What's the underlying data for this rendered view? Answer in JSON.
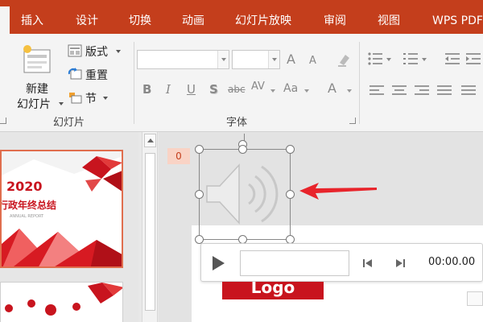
{
  "ribbon_tabs": [
    "插入",
    "设计",
    "切换",
    "动画",
    "幻灯片放映",
    "审阅",
    "视图",
    "WPS PDF"
  ],
  "slides_group": {
    "new_slide_label_line1": "新建",
    "new_slide_label_line2": "幻灯片",
    "layout_label": "版式",
    "reset_label": "重置",
    "section_label": "节",
    "group_label": "幻灯片"
  },
  "font_group": {
    "font_name_value": "",
    "font_size_value": "",
    "grow_label": "A",
    "shrink_label": "A",
    "bold": "B",
    "italic": "I",
    "underline": "U",
    "shadow": "S",
    "strikethrough": "abc",
    "spacing": "AV",
    "change_case": "Aa",
    "font_color": "A",
    "group_label": "字体"
  },
  "thumbnails": {
    "slide1_year": "2020",
    "slide1_title": "行政年终总结",
    "slide1_subtitle": "ANNUAL REPORT"
  },
  "canvas": {
    "slide_number": "0",
    "logo_text": "Logo"
  },
  "player": {
    "time": "00:00.00"
  },
  "colors": {
    "accent": "#c43e1c",
    "arrow": "#e8242b"
  }
}
